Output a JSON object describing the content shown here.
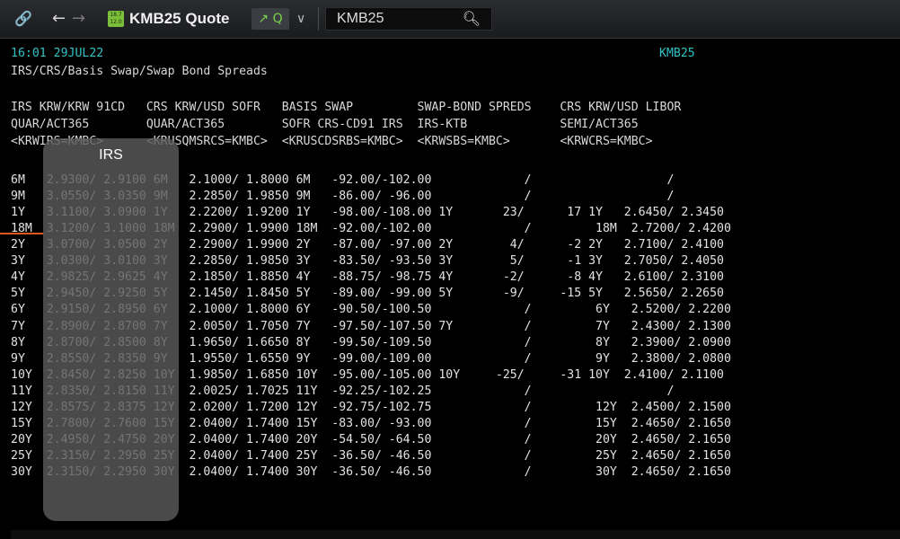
{
  "toolbar": {
    "link_icon": "🔗",
    "back_icon": "←",
    "forward_icon": "→",
    "quote_icon_text": "18.7 12.0",
    "title": "KMB25 Quote",
    "q_button": "↗ Q",
    "dropdown_icon": "∨",
    "search_value": "KMB25",
    "search_icon": "search-icon"
  },
  "terminal": {
    "timestamp": "16:01 29JUL22",
    "ric": "KMB25",
    "subtitle": "IRS/CRS/Basis Swap/Swap Bond Spreads",
    "headers": [
      "IRS KRW/KRW 91CD   CRS KRW/USD SOFR   BASIS SWAP         SWAP-BOND SPREDS    CRS KRW/USD LIBOR",
      "QUAR/ACT365        QUAR/ACT365        SOFR CRS-CD91 IRS  IRS-KTB             SEMI/ACT365",
      "<KRWIRS=KMBC>      <KRUSQMSRCS=KMBC>  <KRUSCDSRBS=KMBC>  <KRWSBS=KMBC>       <KRWCRS=KMBC>"
    ],
    "irs_label": "IRS",
    "rows": [
      "6M   2.9300/ 2.9100 6M   2.1000/ 1.8000 6M   -92.00/-102.00             /                   /",
      "9M   3.0550/ 3.0350 9M   2.2850/ 1.9850 9M   -86.00/ -96.00             /                   /",
      "1Y   3.1100/ 3.0900 1Y   2.2200/ 1.9200 1Y   -98.00/-108.00 1Y       23/      17 1Y   2.6450/ 2.3450",
      "18M  3.1200/ 3.1000 18M  2.2900/ 1.9900 18M  -92.00/-102.00             /         18M  2.7200/ 2.4200",
      "2Y   3.0700/ 3.0500 2Y   2.2900/ 1.9900 2Y   -87.00/ -97.00 2Y        4/      -2 2Y   2.7100/ 2.4100",
      "3Y   3.0300/ 3.0100 3Y   2.2850/ 1.9850 3Y   -83.50/ -93.50 3Y        5/      -1 3Y   2.7050/ 2.4050",
      "4Y   2.9825/ 2.9625 4Y   2.1850/ 1.8850 4Y   -88.75/ -98.75 4Y       -2/      -8 4Y   2.6100/ 2.3100",
      "5Y   2.9450/ 2.9250 5Y   2.1450/ 1.8450 5Y   -89.00/ -99.00 5Y       -9/     -15 5Y   2.5650/ 2.2650",
      "6Y   2.9150/ 2.8950 6Y   2.1000/ 1.8000 6Y   -90.50/-100.50             /         6Y   2.5200/ 2.2200",
      "7Y   2.8900/ 2.8700 7Y   2.0050/ 1.7050 7Y   -97.50/-107.50 7Y          /         7Y   2.4300/ 2.1300",
      "8Y   2.8700/ 2.8500 8Y   1.9650/ 1.6650 8Y   -99.50/-109.50             /         8Y   2.3900/ 2.0900",
      "9Y   2.8550/ 2.8350 9Y   1.9550/ 1.6550 9Y   -99.00/-109.00             /         9Y   2.3800/ 2.0800",
      "10Y  2.8450/ 2.8250 10Y  1.9850/ 1.6850 10Y  -95.00/-105.00 10Y     -25/     -31 10Y  2.4100/ 2.1100",
      "11Y  2.8350/ 2.8150 11Y  2.0025/ 1.7025 11Y  -92.25/-102.25             /                   /",
      "12Y  2.8575/ 2.8375 12Y  2.0200/ 1.7200 12Y  -92.75/-102.75             /         12Y  2.4500/ 2.1500",
      "15Y  2.7800/ 2.7600 15Y  2.0400/ 1.7400 15Y  -83.00/ -93.00             /         15Y  2.4650/ 2.1650",
      "20Y  2.4950/ 2.4750 20Y  2.0400/ 1.7400 20Y  -54.50/ -64.50             /         20Y  2.4650/ 2.1650",
      "25Y  2.3150/ 2.2950 25Y  2.0400/ 1.7400 25Y  -36.50/ -46.50             /         25Y  2.4650/ 2.1650",
      "30Y  2.3150/ 2.2950 30Y  2.0400/ 1.7400 30Y  -36.50/ -46.50             /         30Y  2.4650/ 2.1650"
    ]
  },
  "colors": {
    "timestamp": "#30c2c7",
    "text": "#e2e2e2",
    "highlight": "#5a5a5a",
    "accent_line": "#e2571e",
    "q_button_icon": "#7bd44a"
  }
}
